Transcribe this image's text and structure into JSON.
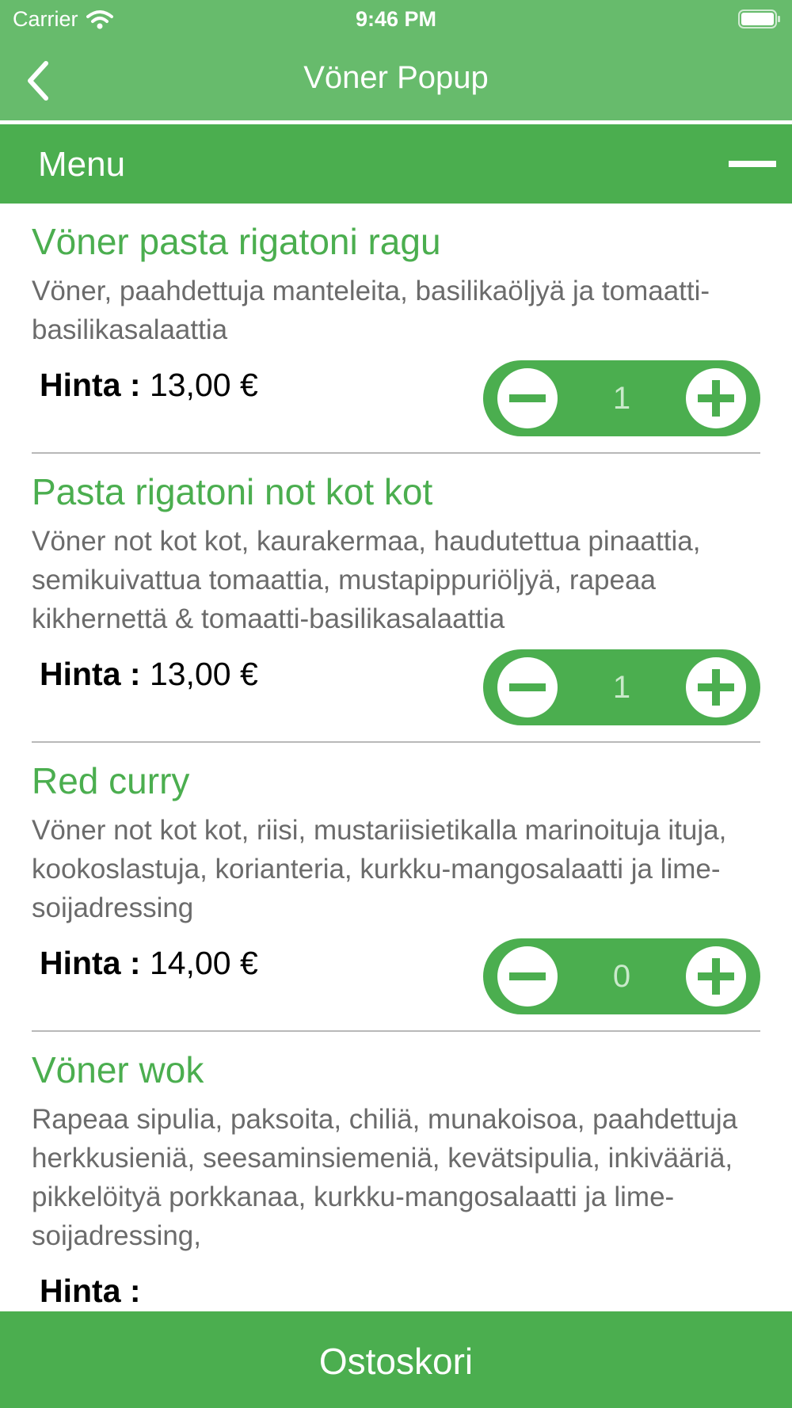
{
  "status_bar": {
    "carrier": "Carrier",
    "time": "9:46 PM",
    "icons": [
      "wifi-icon",
      "battery-icon"
    ]
  },
  "nav": {
    "title": "Vöner Popup",
    "back_icon": "chevron-left-icon"
  },
  "section": {
    "title": "Menu",
    "collapse_icon": "minus-icon"
  },
  "items": [
    {
      "title": "Vöner pasta rigatoni ragu",
      "description": "Vöner, paahdettuja manteleita, basilikaöljyä ja tomaatti-basilikasalaattia",
      "price_label": "Hinta :",
      "price": "13,00 €",
      "quantity": "1"
    },
    {
      "title": "Pasta rigatoni not kot kot",
      "description": "Vöner not kot kot, kaurakermaa, haudutettua pinaattia, semikuivattua tomaattia, mustapippuriöljyä, rapeaa kikhernettä & tomaatti-basilikasalaattia",
      "price_label": "Hinta :",
      "price": "13,00 €",
      "quantity": "1"
    },
    {
      "title": "Red curry",
      "description": "Vöner not kot kot, riisi, mustariisietikalla marinoituja ituja, kookoslastuja, korianteria, kurkku-mangosalaatti ja lime-soijadressing",
      "price_label": "Hinta :",
      "price": "14,00 €",
      "quantity": "0"
    },
    {
      "title": "Vöner wok",
      "description": "Rapeaa sipulia, paksoita, chiliä, munakoisoa, paahdettuja herkkusieniä, seesaminsiemeniä, kevätsipulia, inkivääriä, pikkelöityä porkkanaa, kurkku-mangosalaatti ja lime-soijadressing,",
      "price_label": "Hinta :",
      "price": "",
      "quantity": ""
    }
  ],
  "bottom_bar": {
    "label": "Ostoskori"
  },
  "colors": {
    "top_bar": "#67bb6c",
    "accent_green": "#4bae4f",
    "description_gray": "#6b6b6b",
    "divider": "#b8b8b8"
  }
}
